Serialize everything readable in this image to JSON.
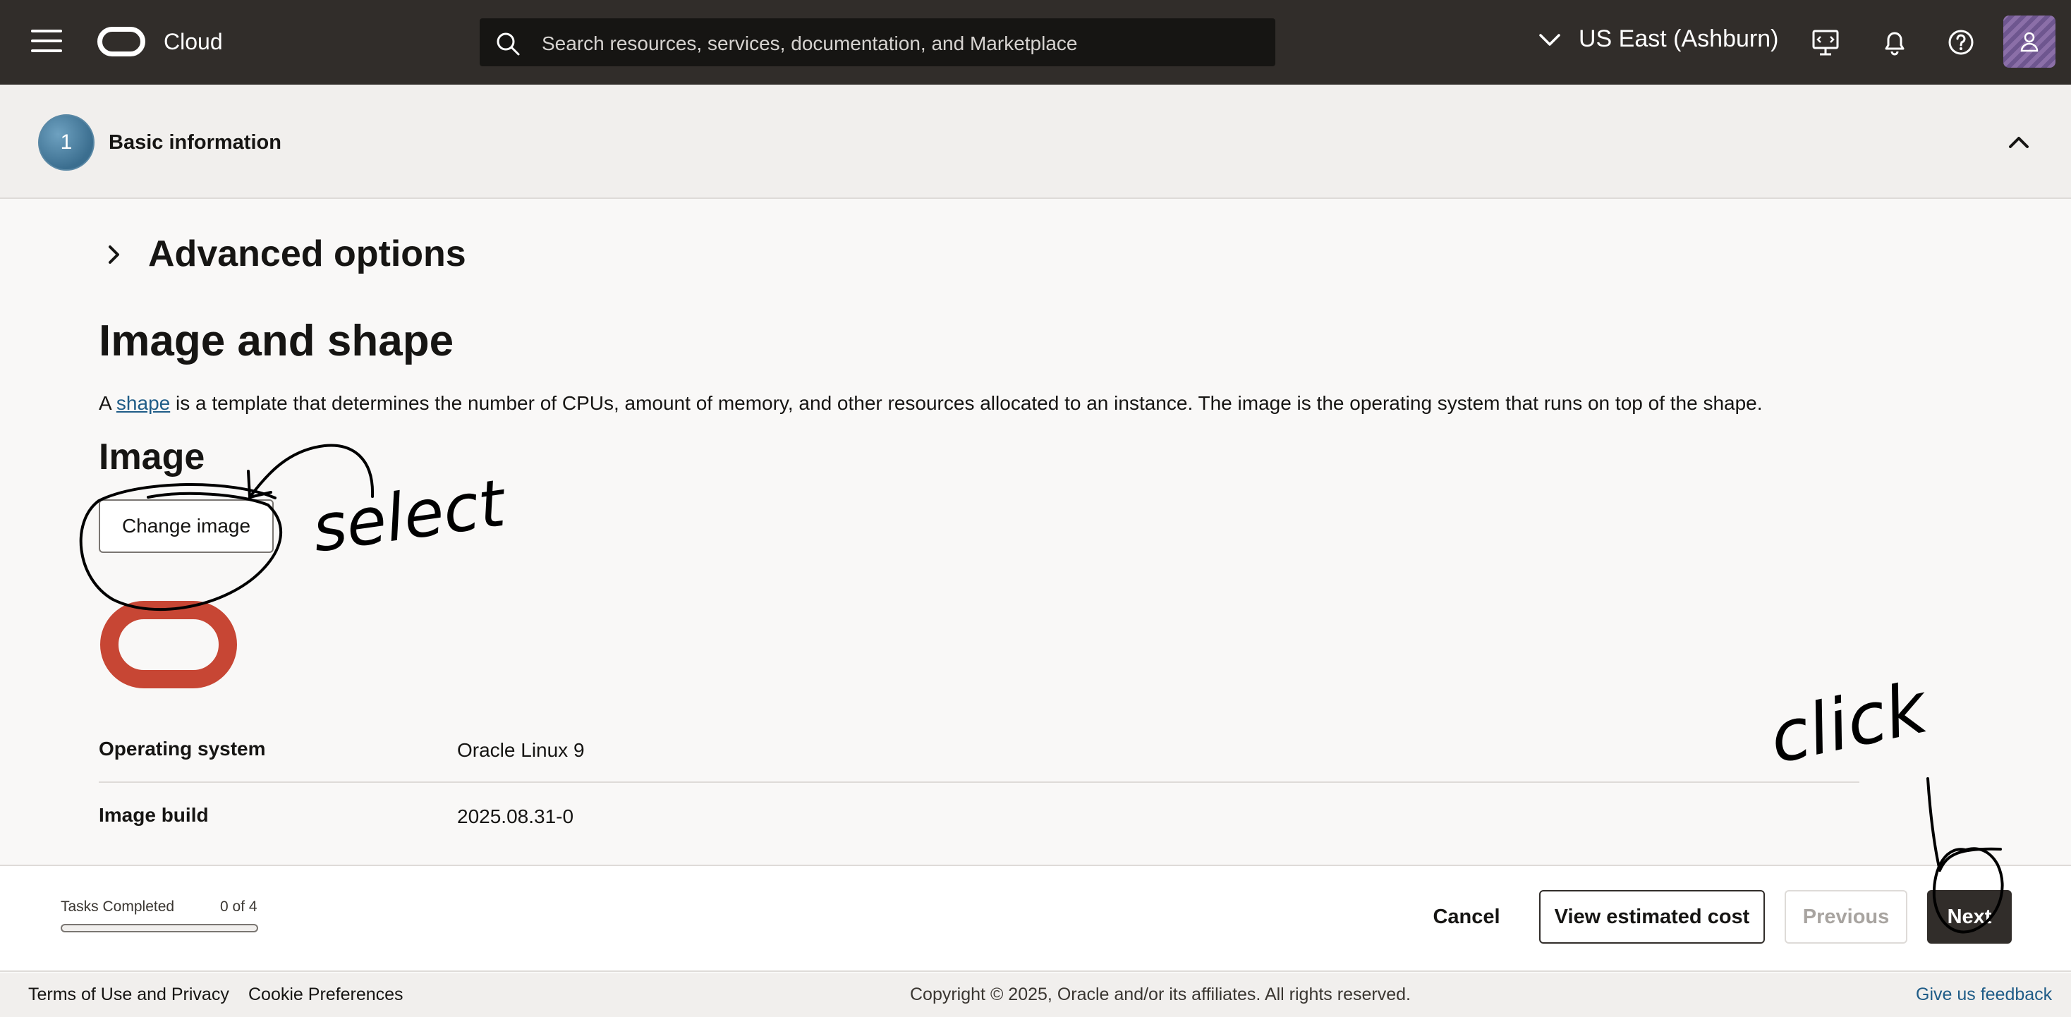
{
  "header": {
    "brand": "Cloud",
    "search_placeholder": "Search resources, services, documentation, and Marketplace",
    "region": "US East (Ashburn)",
    "icons": [
      "menu-icon",
      "oracle-logo-icon",
      "search-icon",
      "chevron-down-icon",
      "developer-tools-icon",
      "bell-icon",
      "help-icon",
      "user-icon"
    ]
  },
  "step": {
    "number": "1",
    "title": "Basic information"
  },
  "main": {
    "advanced_options": "Advanced options",
    "section_title": "Image and shape",
    "description_prefix": "A ",
    "description_link": "shape",
    "description_rest": " is a template that determines the number of CPUs, amount of memory, and other resources allocated to an instance. The image is the operating system that runs on top of the shape.",
    "image_heading": "Image",
    "change_image_label": "Change image",
    "details": [
      {
        "label": "Operating system",
        "value": "Oracle Linux 9"
      },
      {
        "label": "Image build",
        "value": "2025.08.31-0"
      }
    ]
  },
  "actions": {
    "tasks_label": "Tasks Completed",
    "tasks_count": "0 of 4",
    "tasks_progress": 0,
    "cancel": "Cancel",
    "view_cost": "View estimated cost",
    "previous": "Previous",
    "next": "Next"
  },
  "footer": {
    "terms": "Terms of Use and Privacy",
    "cookies": "Cookie Preferences",
    "copyright": "Copyright © 2025, Oracle and/or its affiliates. All rights reserved.",
    "feedback": "Give us feedback"
  },
  "annotations": {
    "select_note": "select",
    "click_note": "click"
  },
  "colors": {
    "topbar": "#312d2a",
    "oracle_red": "#c74634",
    "link": "#1f5c87"
  }
}
